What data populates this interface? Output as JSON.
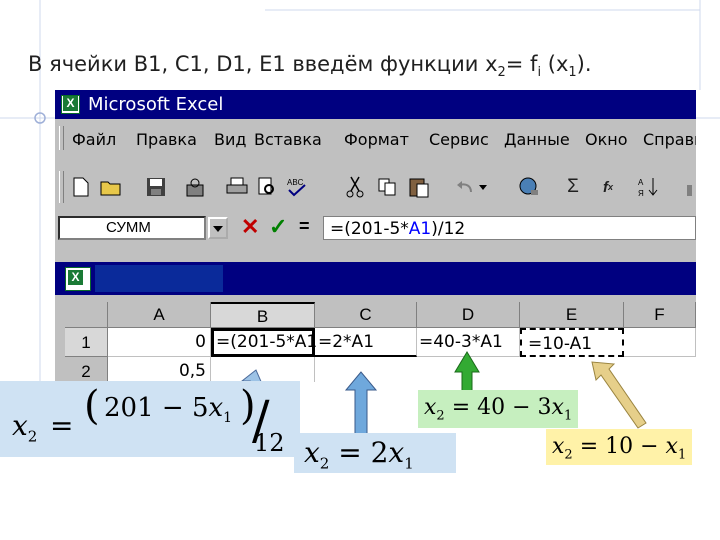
{
  "slide": {
    "title_prefix": "В ячейки B1, C1, D1, E1 введём функции  x",
    "title_sub1": "2",
    "title_mid": "= f",
    "title_sub2": "i",
    "title_mid2": " (x",
    "title_sub3": "1",
    "title_end": ")."
  },
  "excel": {
    "app_title": "Microsoft Excel",
    "menu": [
      "Файл",
      "Правка",
      "Вид",
      "Вставка",
      "Формат",
      "Сервис",
      "Данные",
      "Окно",
      "Справк"
    ],
    "name_box": "СУММ",
    "formula_pre": "=(201-5*",
    "formula_ref": "A1",
    "formula_post": ")/12",
    "columns": [
      "A",
      "B",
      "C",
      "D",
      "E",
      "F"
    ],
    "rows": [
      "1",
      "2"
    ],
    "cells": {
      "A1": "0",
      "B1": "=(201-5*A1",
      "C1": "=2*A1",
      "D1": "=40-3*A1",
      "E1": "=10-A1",
      "A2": "0,5"
    }
  },
  "formulas": {
    "b_left": "x",
    "b_left_sub": "2",
    "b_eq": "=",
    "b_open": "(",
    "b_num": "201 − 5",
    "b_x": "x",
    "b_x_sub": "1",
    "b_close": ")",
    "b_slash": "/",
    "b_den": "12",
    "c_text": "x",
    "c_sub": "2",
    "c_rest": " = 2",
    "c_x": "x",
    "c_x_sub": "1",
    "d_text": "x",
    "d_sub": "2",
    "d_rest": " = 40 − 3",
    "d_x": "x",
    "d_x_sub": "1",
    "e_text": "x",
    "e_sub": "2",
    "e_rest": " = 10 − ",
    "e_x": "x",
    "e_x_sub": "1"
  },
  "colors": {
    "arrow_b": "#9dc3e6",
    "arrow_c": "#6fa8dc",
    "arrow_d": "#33aa33",
    "arrow_e": "#e6cf8a",
    "box_b": "#cfe2f3",
    "box_c": "#cfe2f3",
    "box_d": "#c6efbf",
    "box_e": "#fff2a8"
  }
}
